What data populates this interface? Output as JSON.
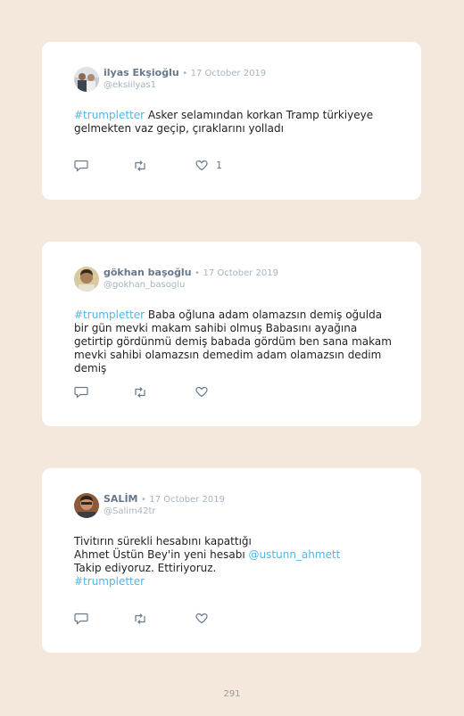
{
  "tweets": [
    {
      "name": "ilyas Ekşioğlu",
      "separator": "•",
      "date": "17 October 2019",
      "handle": "@eksiilyas1",
      "hashtag": "#trumpletter",
      "text": " Asker selamından korkan Tramp türkiyeye gelmekten vaz geçip, çıraklarını yolladı",
      "like_count": "1",
      "icons": [
        "reply-icon",
        "retweet-icon",
        "heart-icon"
      ]
    },
    {
      "name": "gökhan başoğlu",
      "separator": "•",
      "date": "17 October 2019",
      "handle": "@gokhan_basoglu",
      "hashtag": "#trumpletter",
      "text": " Baba oğluna adam olamazsın demiş oğulda bir gün mevki makam sahibi olmuş Babasını ayağına getirtip gördünmü demiş babada gördüm ben sana makam mevki sahibi olamazsın demedim adam olamazsın dedim demiş",
      "icons": [
        "reply-icon",
        "retweet-icon",
        "heart-icon"
      ]
    },
    {
      "name": "SALİM",
      "separator": "•",
      "date": "17 October 2019",
      "handle": "@Salim42tr",
      "text_line1": "Tivitırın sürekli hesabını kapattığı",
      "text_line2": "Ahmet Üstün Bey'in yeni hesabı ",
      "mention": "@ustunn_ahmett",
      "text_line3": "Takip ediyoruz. Ettiriyoruz.",
      "hashtag": "#trumpletter",
      "icons": [
        "reply-icon",
        "retweet-icon",
        "heart-icon"
      ]
    }
  ],
  "page_number": "291",
  "colors": {
    "background": "#f4e8dc",
    "link": "#52b5e8",
    "name": "#66788a",
    "muted": "#a8b4bf"
  }
}
